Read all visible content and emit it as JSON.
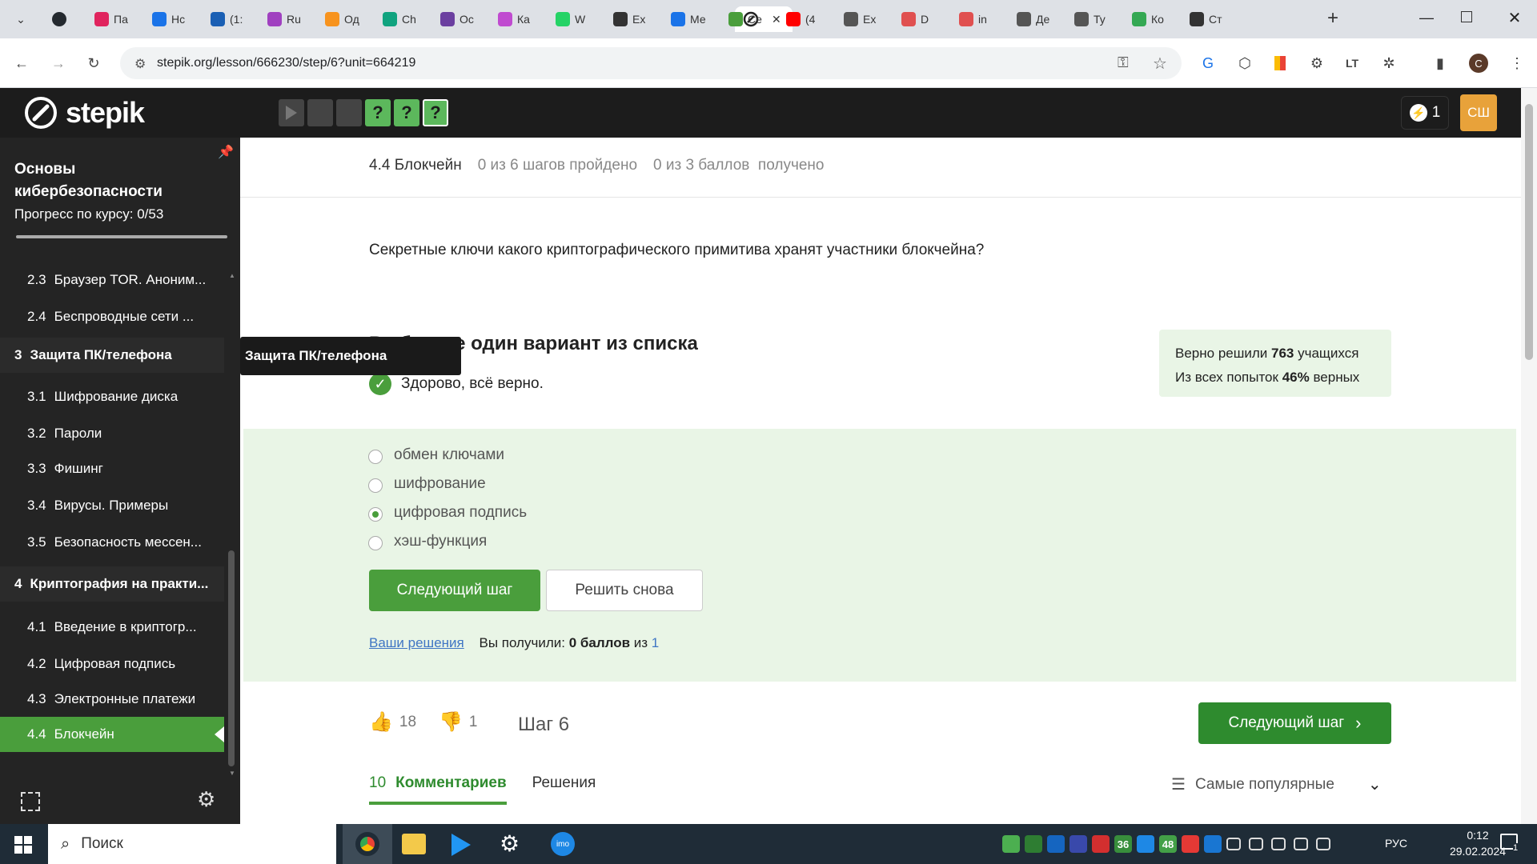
{
  "browser": {
    "tabs": [
      {
        "label": "Па",
        "color": "#e0245e"
      },
      {
        "label": "Нс",
        "color": "#1a73e8"
      },
      {
        "label": "(1:",
        "color": "#1a5fb4"
      },
      {
        "label": "Ru",
        "color": "#a040c0"
      },
      {
        "label": "Од",
        "color": "#f7931e"
      },
      {
        "label": "Ch",
        "color": "#10a37f"
      },
      {
        "label": "Ос",
        "color": "#6b3fa0"
      },
      {
        "label": "Ка",
        "color": "#c04bd0"
      },
      {
        "label": "W",
        "color": "#25d366"
      },
      {
        "label": "Ех",
        "color": "#333333"
      },
      {
        "label": "Ме",
        "color": "#1a73e8"
      },
      {
        "label": "Се",
        "color": "#4a9e3c"
      },
      {
        "label": "(4",
        "color": "#ff0000"
      },
      {
        "label": "Ех",
        "color": "#555555"
      },
      {
        "label": "D",
        "color": "#e05050"
      },
      {
        "label": "in",
        "color": "#e05050"
      },
      {
        "label": "Де",
        "color": "#555555"
      },
      {
        "label": "Ту",
        "color": "#555555"
      },
      {
        "label": "Ко",
        "color": "#34a853"
      },
      {
        "label": "Ст",
        "color": "#333333"
      }
    ],
    "active_tab_close": "✕",
    "new_tab": "+",
    "url": "stepik.org/lesson/666230/step/6?unit=664219",
    "profile_initial": "C"
  },
  "header": {
    "logo_text": "stepik",
    "step_nav": [
      {
        "kind": "video",
        "label": ""
      },
      {
        "kind": "text",
        "label": ""
      },
      {
        "kind": "text",
        "label": ""
      },
      {
        "kind": "quiz",
        "label": "?"
      },
      {
        "kind": "quiz",
        "label": "?"
      },
      {
        "kind": "quiz",
        "label": "?"
      }
    ],
    "energy_count": "1",
    "avatar": "СШ"
  },
  "sidebar": {
    "course_title": "Основы кибербезопасности",
    "progress_label": "Прогресс по курсу:",
    "progress_value": "0/53",
    "items": [
      {
        "type": "sub",
        "num": "2.3",
        "label": "Браузер TOR. Аноним..."
      },
      {
        "type": "sub",
        "num": "2.4",
        "label": "Беспроводные сети ..."
      },
      {
        "type": "mod",
        "num": "3",
        "label": "Защита ПК/телефона"
      },
      {
        "type": "sub",
        "num": "3.1",
        "label": "Шифрование диска"
      },
      {
        "type": "sub",
        "num": "3.2",
        "label": "Пароли"
      },
      {
        "type": "sub",
        "num": "3.3",
        "label": "Фишинг"
      },
      {
        "type": "sub",
        "num": "3.4",
        "label": "Вирусы. Примеры"
      },
      {
        "type": "sub",
        "num": "3.5",
        "label": "Безопасность мессен..."
      },
      {
        "type": "mod",
        "num": "4",
        "label": "Криптография на практи..."
      },
      {
        "type": "sub",
        "num": "4.1",
        "label": "Введение в криптогр..."
      },
      {
        "type": "sub",
        "num": "4.2",
        "label": "Цифровая подпись"
      },
      {
        "type": "sub",
        "num": "4.3",
        "label": "Электронные платежи"
      },
      {
        "type": "sub",
        "num": "4.4",
        "label": "Блокчейн"
      }
    ],
    "tooltip": "Защита ПК/телефона"
  },
  "lesson": {
    "title": "4.4 Блокчейн",
    "steps_progress": "0 из 6 шагов пройдено",
    "points_progress": "0 из 3 баллов  получено"
  },
  "quiz": {
    "question": "Секретные ключи какого криптографического примитива хранят участники блокчейна?",
    "instruction": "Выберите один вариант из списка",
    "feedback": "Здорово, всё верно.",
    "stats_line1_pre": "Верно решили ",
    "stats_line1_num": "763",
    "stats_line1_post": " учащихся",
    "stats_line2_pre": "Из всех попыток ",
    "stats_line2_num": "46%",
    "stats_line2_post": " верных",
    "options": [
      {
        "label": "обмен ключами",
        "selected": false
      },
      {
        "label": "шифрование",
        "selected": false
      },
      {
        "label": "цифровая подпись",
        "selected": true
      },
      {
        "label": "хэш-функция",
        "selected": false
      }
    ],
    "next_button": "Следующий шаг",
    "retry_button": "Решить снова",
    "your_solutions_link": "Ваши решения",
    "score_pre": "Вы получили: ",
    "score_value": "0 баллов",
    "score_mid": " из ",
    "score_max": "1"
  },
  "footer": {
    "likes": "18",
    "dislikes": "1",
    "step_label": "Шаг 6",
    "next_step_button": "Следующий шаг",
    "tabs": [
      {
        "count": "10",
        "label": "Комментариев"
      },
      {
        "count": "",
        "label": "Решения"
      }
    ],
    "sort_label": "Самые популярные"
  },
  "taskbar": {
    "search_placeholder": "Поиск",
    "lang": "РУС",
    "time": "0:12",
    "date": "29.02.2024",
    "notif_count": "1",
    "tray_badges": [
      "36",
      "48"
    ]
  },
  "colors": {
    "stepik_green": "#4a9e3c",
    "quiz_bg": "#e9f5e6",
    "stats_bg": "#e9f5e6",
    "sidebar_bg": "#242424",
    "header_bg": "#1c1c1c",
    "link_blue": "#3f75c4"
  }
}
